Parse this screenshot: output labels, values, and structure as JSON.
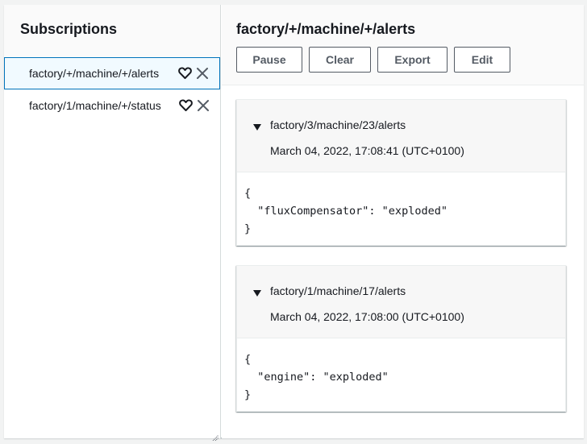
{
  "sidebar": {
    "title": "Subscriptions",
    "items": [
      {
        "topic": "factory/+/machine/+/alerts",
        "selected": true,
        "favorite_icon": "heart-icon",
        "remove_icon": "close-icon"
      },
      {
        "topic": "factory/1/machine/+/status",
        "selected": false,
        "favorite_icon": "heart-icon",
        "remove_icon": "close-icon"
      }
    ]
  },
  "main": {
    "title": "factory/+/machine/+/alerts",
    "toolbar": {
      "pause_label": "Pause",
      "clear_label": "Clear",
      "export_label": "Export",
      "edit_label": "Edit"
    },
    "messages": [
      {
        "topic": "factory/3/machine/23/alerts",
        "timestamp": "March 04, 2022, 17:08:41 (UTC+0100)",
        "payload": "{\n  \"fluxCompensator\": \"exploded\"\n}",
        "expanded": true
      },
      {
        "topic": "factory/1/machine/17/alerts",
        "timestamp": "March 04, 2022, 17:08:00 (UTC+0100)",
        "payload": "{\n  \"engine\": \"exploded\"\n}",
        "expanded": true
      }
    ]
  },
  "colors": {
    "selected_border": "#0073bb",
    "selected_bg": "#f1faff",
    "button_border": "#545b64"
  }
}
